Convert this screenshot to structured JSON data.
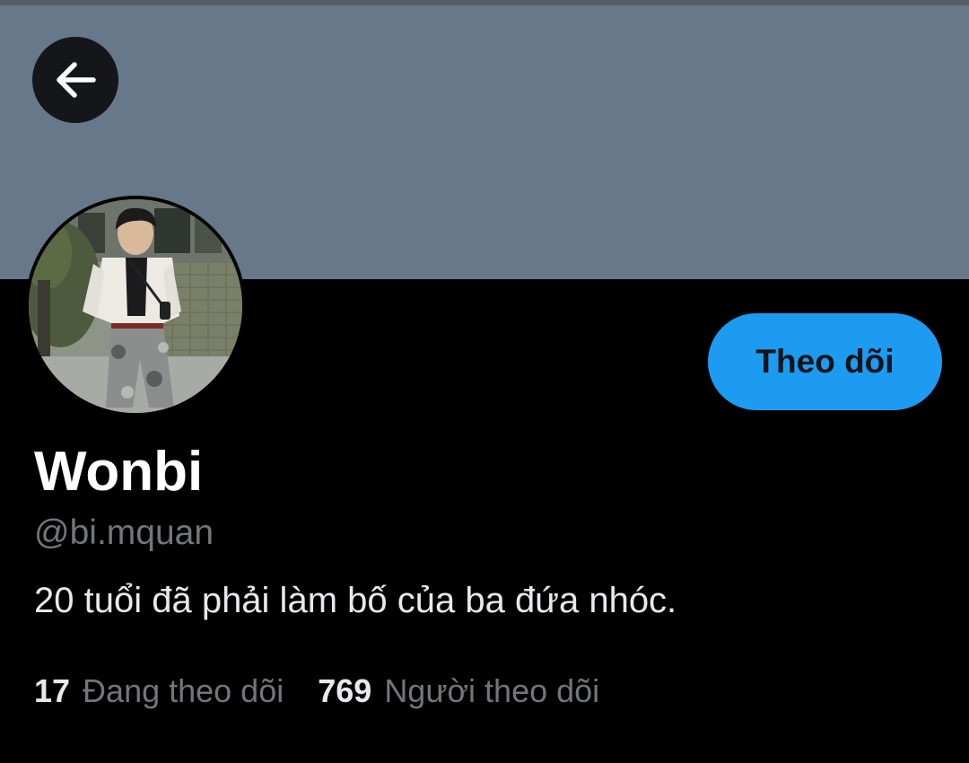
{
  "profile": {
    "display_name": "Wonbi",
    "handle": "@bi.mquan",
    "bio": "20 tuổi đã phải làm bố của ba đứa nhóc."
  },
  "actions": {
    "back_icon": "arrow-left-icon",
    "follow_label": "Theo dõi"
  },
  "stats": {
    "following_count": "17",
    "following_label": "Đang theo dõi",
    "followers_count": "769",
    "followers_label": "Người theo dõi"
  },
  "colors": {
    "banner": "#66788a",
    "accent": "#1d9bf0",
    "background": "#000000",
    "secondary_text": "#71767b"
  }
}
